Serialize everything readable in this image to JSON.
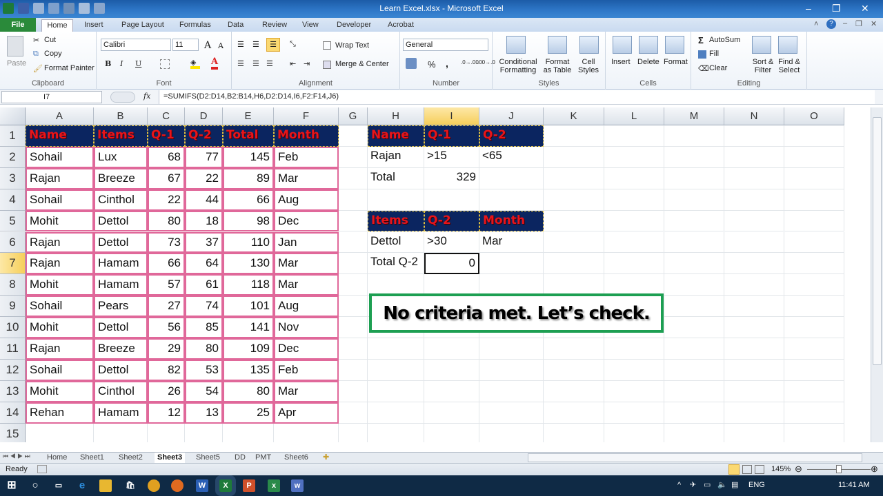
{
  "window": {
    "title": "Learn Excel.xlsx - Microsoft Excel",
    "controls": {
      "minimize": "–",
      "restore": "❐",
      "close": "✕"
    }
  },
  "ribbon_tabs": [
    "File",
    "Home",
    "Insert",
    "Page Layout",
    "Formulas",
    "Data",
    "Review",
    "View",
    "Developer",
    "Acrobat"
  ],
  "ribbon": {
    "clipboard": {
      "paste": "Paste",
      "cut": "Cut",
      "copy": "Copy",
      "format_painter": "Format Painter",
      "label": "Clipboard"
    },
    "font": {
      "name": "Calibri",
      "size": "11",
      "bold": "B",
      "italic": "I",
      "underline": "U",
      "label": "Font"
    },
    "alignment": {
      "wrap_text": "Wrap Text",
      "merge_center": "Merge & Center",
      "label": "Alignment"
    },
    "number": {
      "format": "General",
      "percent": "%",
      "comma": ",",
      "label": "Number"
    },
    "styles": {
      "conditional_formatting": "Conditional Formatting",
      "format_as_table": "Format as Table",
      "cell_styles": "Cell Styles",
      "label": "Styles"
    },
    "cells": {
      "insert": "Insert",
      "delete": "Delete",
      "format": "Format",
      "label": "Cells"
    },
    "editing": {
      "autosum": "AutoSum",
      "fill": "Fill",
      "clear": "Clear",
      "sort_filter": "Sort & Filter",
      "find_select": "Find & Select",
      "label": "Editing"
    }
  },
  "formula_bar": {
    "name_box": "I7",
    "fx": "fx",
    "formula": "=SUMIFS(D2:D14,B2:B14,H6,D2:D14,I6,F2:F14,J6)"
  },
  "columns": [
    "A",
    "B",
    "C",
    "D",
    "E",
    "F",
    "G",
    "H",
    "I",
    "J",
    "K",
    "L",
    "M",
    "N",
    "O"
  ],
  "rows": [
    "1",
    "2",
    "3",
    "4",
    "5",
    "6",
    "7",
    "8",
    "9",
    "10",
    "11",
    "12",
    "13",
    "14",
    "15"
  ],
  "table": {
    "headers": [
      "Name",
      "Items",
      "Q-1",
      "Q-2",
      "Total",
      "Month"
    ],
    "rows": [
      [
        "Sohail",
        "Lux",
        "68",
        "77",
        "145",
        "Feb"
      ],
      [
        "Rajan",
        "Breeze",
        "67",
        "22",
        "89",
        "Mar"
      ],
      [
        "Sohail",
        "Cinthol",
        "22",
        "44",
        "66",
        "Aug"
      ],
      [
        "Mohit",
        "Dettol",
        "80",
        "18",
        "98",
        "Dec"
      ],
      [
        "Rajan",
        "Dettol",
        "73",
        "37",
        "110",
        "Jan"
      ],
      [
        "Rajan",
        "Hamam",
        "66",
        "64",
        "130",
        "Mar"
      ],
      [
        "Mohit",
        "Hamam",
        "57",
        "61",
        "118",
        "Mar"
      ],
      [
        "Sohail",
        "Pears",
        "27",
        "74",
        "101",
        "Aug"
      ],
      [
        "Mohit",
        "Dettol",
        "56",
        "85",
        "141",
        "Nov"
      ],
      [
        "Rajan",
        "Breeze",
        "29",
        "80",
        "109",
        "Dec"
      ],
      [
        "Sohail",
        "Dettol",
        "82",
        "53",
        "135",
        "Feb"
      ],
      [
        "Mohit",
        "Cinthol",
        "26",
        "54",
        "80",
        "Mar"
      ],
      [
        "Rehan",
        "Hamam",
        "12",
        "13",
        "25",
        "Apr"
      ]
    ]
  },
  "criteria1": {
    "headers": [
      "Name",
      "Q-1",
      "Q-2"
    ],
    "values": [
      "Rajan",
      ">15",
      "<65"
    ],
    "total_label": "Total",
    "total_value": "329"
  },
  "criteria2": {
    "headers": [
      "Items",
      "Q-2",
      "Month"
    ],
    "values": [
      "Dettol",
      ">30",
      "Mar"
    ],
    "total_label": "Total Q-2",
    "total_value": "0"
  },
  "annotation": "No criteria met. Let’s check.",
  "sheet_tabs": [
    "Home",
    "Sheet1",
    "Sheet2",
    "Sheet3",
    "Sheet5",
    "DD",
    "PMT",
    "Sheet6"
  ],
  "active_sheet": "Sheet3",
  "status": {
    "ready": "Ready",
    "zoom": "145%"
  },
  "taskbar": {
    "lang": "ENG",
    "time": "11:41 AM"
  }
}
